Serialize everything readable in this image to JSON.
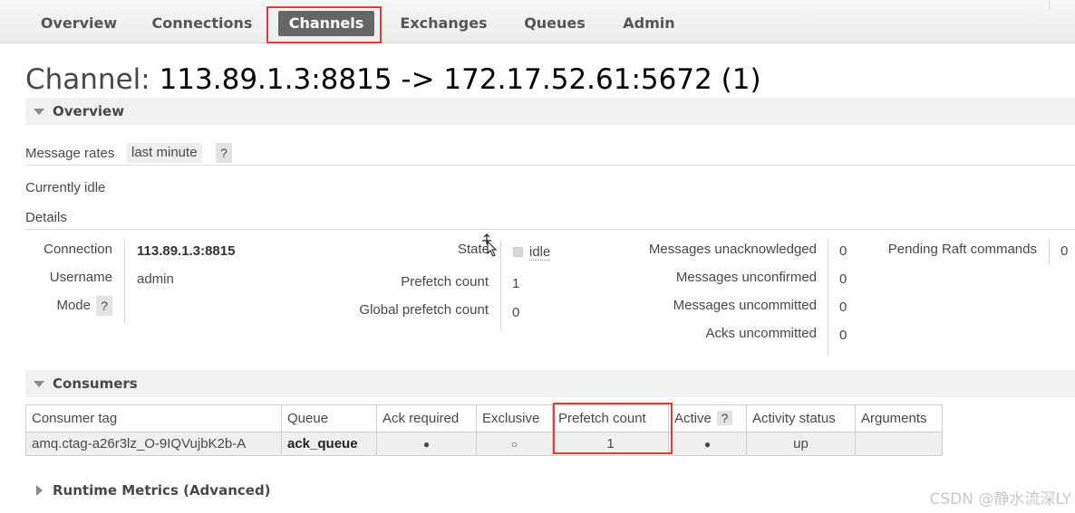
{
  "nav": {
    "tabs": [
      "Overview",
      "Connections",
      "Channels",
      "Exchanges",
      "Queues",
      "Admin"
    ],
    "active": "Channels"
  },
  "page": {
    "title_prefix": "Channel:",
    "title_value": "113.89.1.3:8815 -> 172.17.52.61:5672 (1)"
  },
  "overview": {
    "header": "Overview",
    "message_rates_label": "Message rates",
    "message_rates_value": "last minute",
    "help": "?",
    "currently_idle": "Currently idle",
    "details_label": "Details",
    "details": {
      "connection_label": "Connection",
      "connection_value": "113.89.1.3:8815",
      "username_label": "Username",
      "username_value": "admin",
      "mode_label": "Mode",
      "state_label": "State",
      "state_value": "idle",
      "prefetch_label": "Prefetch count",
      "prefetch_value": "1",
      "global_prefetch_label": "Global prefetch count",
      "global_prefetch_value": "0",
      "msgs_unacked_label": "Messages unacknowledged",
      "msgs_unacked_value": "0",
      "msgs_unconfirmed_label": "Messages unconfirmed",
      "msgs_unconfirmed_value": "0",
      "msgs_uncommitted_label": "Messages uncommitted",
      "msgs_uncommitted_value": "0",
      "acks_uncommitted_label": "Acks uncommitted",
      "acks_uncommitted_value": "0",
      "pending_raft_label": "Pending Raft commands",
      "pending_raft_value": "0"
    }
  },
  "consumers": {
    "header": "Consumers",
    "columns": [
      "Consumer tag",
      "Queue",
      "Ack required",
      "Exclusive",
      "Prefetch count",
      "Active",
      "Activity status",
      "Arguments"
    ],
    "active_help": "?",
    "rows": [
      {
        "consumer_tag": "amq.ctag-a26r3lz_O-9IQVujbK2b-A",
        "queue": "ack_queue",
        "ack_required": "●",
        "exclusive": "○",
        "prefetch_count": "1",
        "active": "●",
        "activity_status": "up",
        "arguments": ""
      }
    ]
  },
  "runtime": {
    "header": "Runtime Metrics (Advanced)"
  },
  "watermark": "CSDN @静水流深LY",
  "colors": {
    "highlight": "#e53935",
    "active_tab_bg": "#666666"
  }
}
